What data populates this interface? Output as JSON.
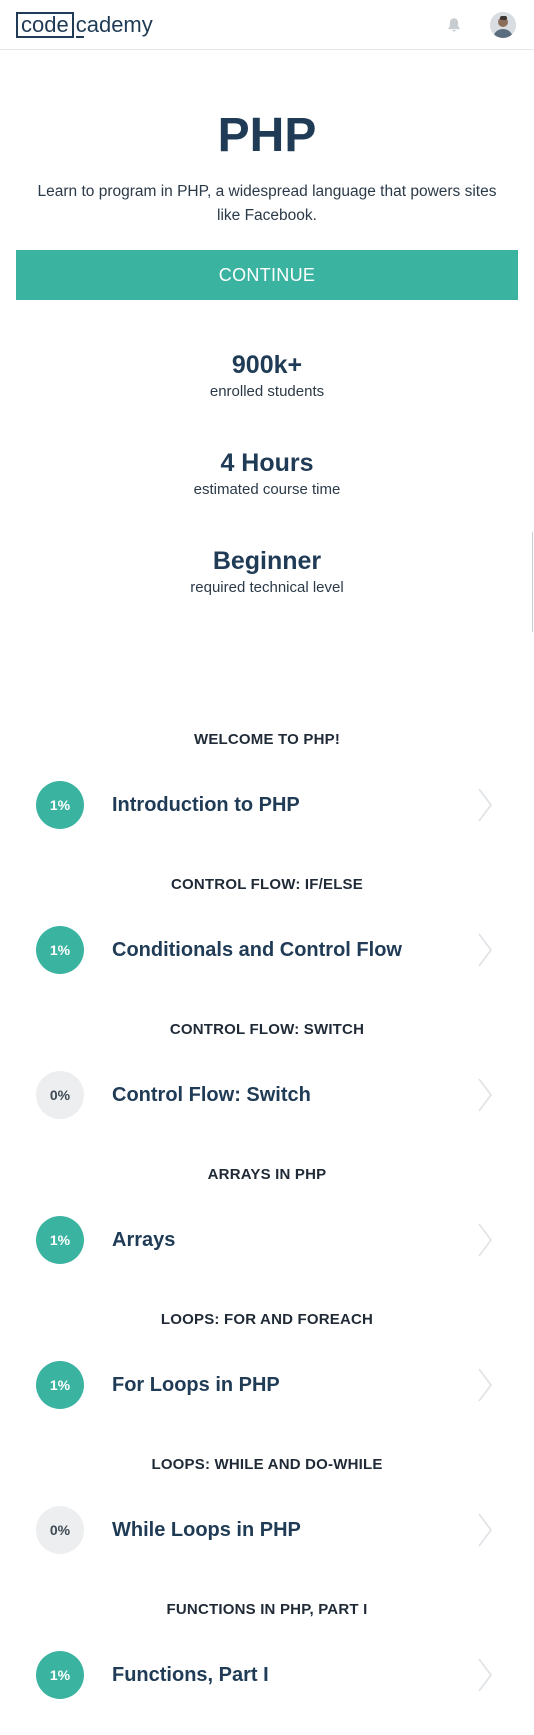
{
  "header": {
    "logo": {
      "boxed": "code",
      "rest": "cademy"
    },
    "icons": {
      "bell": "bell-icon",
      "avatar": "user-avatar"
    }
  },
  "course": {
    "title": "PHP",
    "description": "Learn to program in PHP, a widespread language that powers sites like Facebook.",
    "cta_label": "CONTINUE"
  },
  "stats": [
    {
      "value": "900k+",
      "label": "enrolled students"
    },
    {
      "value": "4 Hours",
      "label": "estimated course time"
    },
    {
      "value": "Beginner",
      "label": "required technical level"
    }
  ],
  "syllabus": [
    {
      "heading": "WELCOME TO PHP!",
      "lesson": "Introduction to PHP",
      "progress": "1%",
      "started": true
    },
    {
      "heading": "CONTROL FLOW: IF/ELSE",
      "lesson": "Conditionals and Control Flow",
      "progress": "1%",
      "started": true
    },
    {
      "heading": "CONTROL FLOW: SWITCH",
      "lesson": "Control Flow: Switch",
      "progress": "0%",
      "started": false
    },
    {
      "heading": "ARRAYS IN PHP",
      "lesson": "Arrays",
      "progress": "1%",
      "started": true
    },
    {
      "heading": "LOOPS: FOR AND FOREACH",
      "lesson": "For Loops in PHP",
      "progress": "1%",
      "started": true
    },
    {
      "heading": "LOOPS: WHILE AND DO-WHILE",
      "lesson": "While Loops in PHP",
      "progress": "0%",
      "started": false
    },
    {
      "heading": "FUNCTIONS IN PHP, PART I",
      "lesson": "Functions, Part I",
      "progress": "1%",
      "started": true
    }
  ],
  "colors": {
    "accent": "#3bb3a1",
    "navy": "#1f3b55",
    "empty_progress": "#eceef0"
  }
}
